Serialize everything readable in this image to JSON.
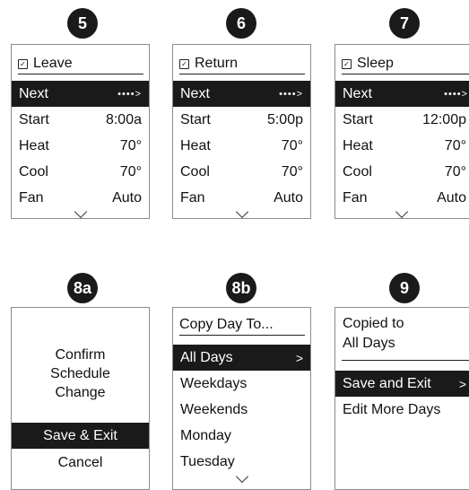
{
  "steps": [
    "5",
    "6",
    "7",
    "8a",
    "8b",
    "9"
  ],
  "leave": {
    "title": "Leave",
    "rows": [
      {
        "label": "Next",
        "value": "••••>"
      },
      {
        "label": "Start",
        "value": "8:00a"
      },
      {
        "label": "Heat",
        "value": "70°"
      },
      {
        "label": "Cool",
        "value": "70°"
      },
      {
        "label": "Fan",
        "value": "Auto"
      }
    ]
  },
  "return": {
    "title": "Return",
    "rows": [
      {
        "label": "Next",
        "value": "••••>"
      },
      {
        "label": "Start",
        "value": "5:00p"
      },
      {
        "label": "Heat",
        "value": "70°"
      },
      {
        "label": "Cool",
        "value": "70°"
      },
      {
        "label": "Fan",
        "value": "Auto"
      }
    ]
  },
  "sleep": {
    "title": "Sleep",
    "rows": [
      {
        "label": "Next",
        "value": "••••>"
      },
      {
        "label": "Start",
        "value": "12:00p"
      },
      {
        "label": "Heat",
        "value": "70°"
      },
      {
        "label": "Cool",
        "value": "70°"
      },
      {
        "label": "Fan",
        "value": "Auto"
      }
    ]
  },
  "confirm": {
    "message": [
      "Confirm",
      "Schedule",
      "Change"
    ],
    "save": "Save & Exit",
    "cancel": "Cancel"
  },
  "copy": {
    "title": "Copy Day To...",
    "selected": "All Days",
    "selected_arrow": ">",
    "items": [
      "Weekdays",
      "Weekends",
      "Monday",
      "Tuesday"
    ]
  },
  "copied": {
    "message": [
      "Copied to",
      "All Days"
    ],
    "selected": "Save and Exit",
    "selected_arrow": ">",
    "other": "Edit More Days"
  }
}
